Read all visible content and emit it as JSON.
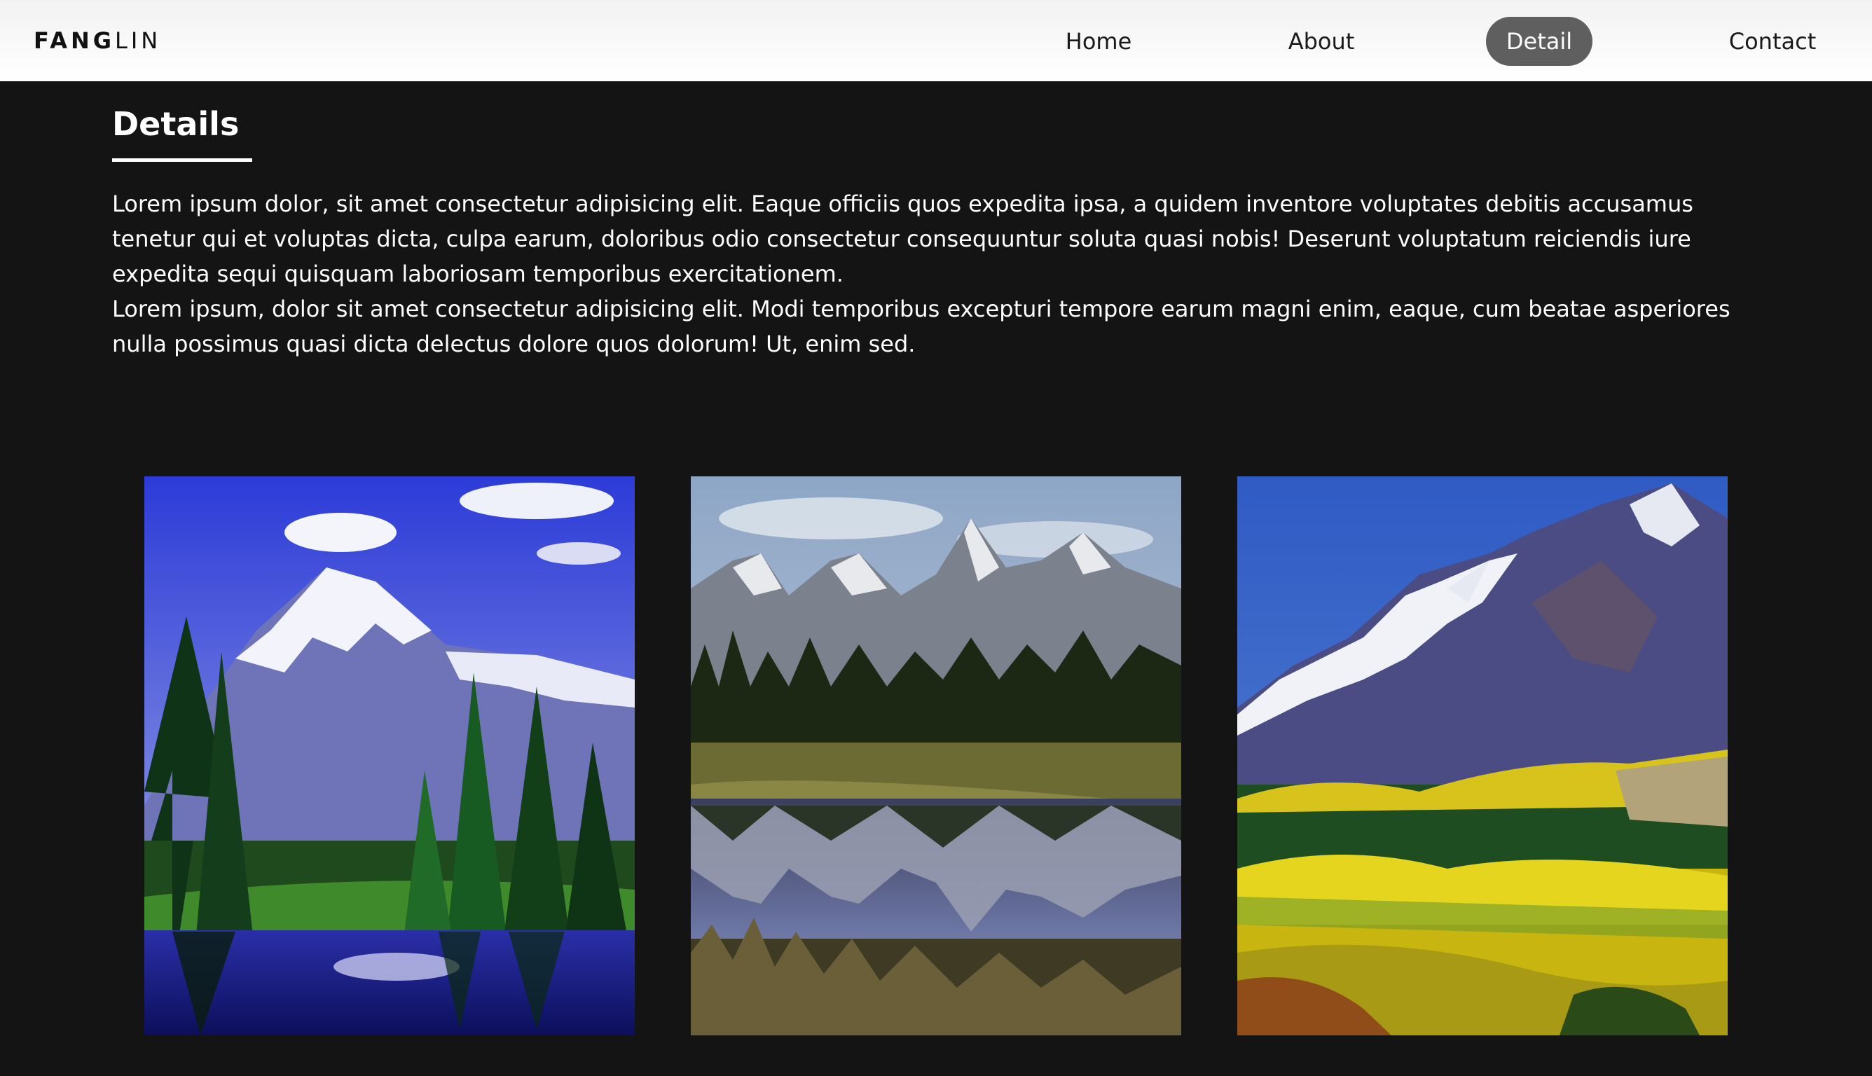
{
  "brand": {
    "logo_bold": "FANG",
    "logo_light": "LIN"
  },
  "nav": {
    "items": [
      {
        "label": "Home",
        "active": false
      },
      {
        "label": "About",
        "active": false
      },
      {
        "label": "Detail",
        "active": true
      },
      {
        "label": "Contact",
        "active": false
      }
    ]
  },
  "details": {
    "title": "Details",
    "paragraphs": [
      "Lorem ipsum dolor, sit amet consectetur adipisicing elit. Eaque officiis quos expedita ipsa, a quidem inventore voluptates debitis accusamus tenetur qui et voluptas dicta, culpa earum, doloribus odio consectetur consequuntur soluta quasi nobis! Deserunt voluptatum reiciendis iure expedita sequi quisquam laboriosam temporibus exercitationem.",
      "Lorem ipsum, dolor sit amet consectetur adipisicing elit. Modi temporibus excepturi tempore earum magni enim, eaque, cum beatae asperiores nulla possimus quasi dicta delectus dolore quos dolorum! Ut, enim sed."
    ]
  },
  "colors": {
    "page_background": "#141414",
    "nav_background": "#ffffff",
    "nav_active_pill": "#5f5f5f",
    "text_light": "#ffffff",
    "text_dark": "#1a1a1a"
  }
}
